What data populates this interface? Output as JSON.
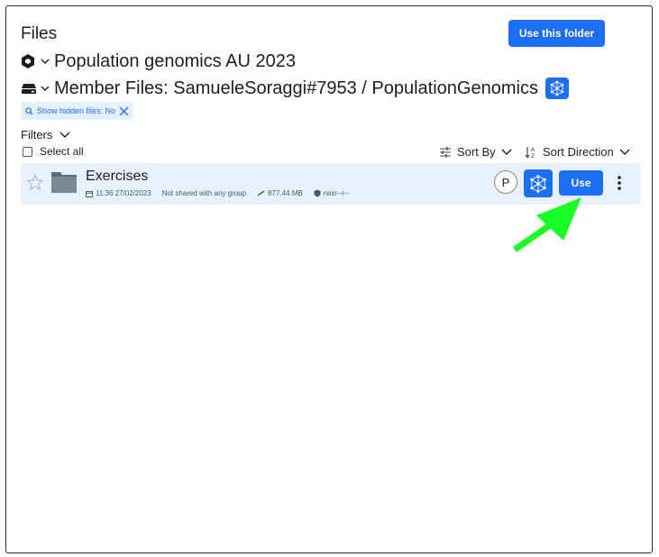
{
  "dialog": {
    "title": "Files",
    "use_folder_label": "Use this folder"
  },
  "breadcrumbs": {
    "project": "Population genomics AU 2023",
    "path": "Member Files: SamueleSoraggi#7953 / PopulationGenomics"
  },
  "filter_chip": {
    "label": "Show hidden files: No"
  },
  "toolbar": {
    "filters_label": "Filters",
    "select_all_label": "Select all",
    "sort_by_label": "Sort By",
    "sort_direction_label": "Sort Direction"
  },
  "files": [
    {
      "name": "Exercises",
      "modified": "11:36 27/02/2023",
      "sharing": "Not shared with any group",
      "size": "877.44 MB",
      "permissions": "rwxr--r--",
      "avatar_initial": "P",
      "use_label": "Use"
    }
  ],
  "colors": {
    "accent": "#1d6ff2",
    "row_highlight": "#e8f0fc",
    "arrow": "#19ff26"
  },
  "icons": {
    "project": "hexagon-icon",
    "drive": "drive-icon",
    "app": "network-app-icon",
    "favorite": "star-icon",
    "folder": "folder-icon",
    "more": "kebab-menu-icon"
  }
}
